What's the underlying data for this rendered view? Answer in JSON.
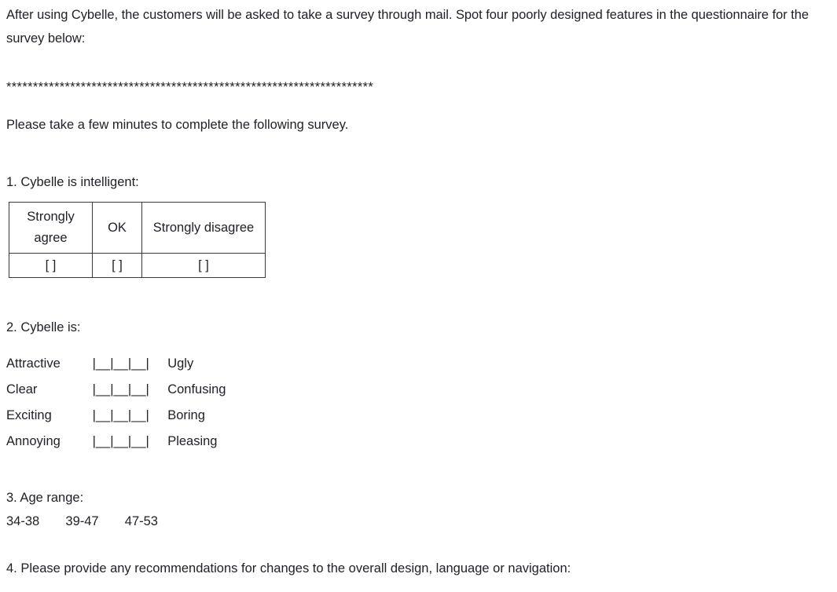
{
  "document": {
    "intro": "After using Cybelle, the customers will be asked to take a survey through mail. Spot four poorly designed features in the questionnaire for the survey below:",
    "separator": "*********************************************************************",
    "instruction": "Please take a few minutes to complete the following survey.",
    "text_color": "#21212a",
    "background_color": "#ffffff",
    "border_color": "#3a3a3a"
  },
  "questions": [
    {
      "id": "q1",
      "label": "1. Cybelle is intelligent:",
      "type": "table",
      "table": {
        "headers": [
          "Strongly agree",
          "OK",
          "Strongly disagree"
        ],
        "cells": [
          "[ ]",
          "[ ]",
          "[ ]"
        ]
      }
    },
    {
      "id": "q2",
      "label": "2. Cybelle is:",
      "type": "semantic-differential",
      "scale_marker": "|__|__|__|",
      "rows": [
        {
          "left": "Attractive",
          "scale": "|__|__|__|",
          "right": "Ugly"
        },
        {
          "left": "Clear",
          "scale": "|__|__|__|",
          "right": "Confusing"
        },
        {
          "left": "Exciting",
          "scale": "|__|__|__|",
          "right": "Boring"
        },
        {
          "left": "Annoying",
          "scale": "|__|__|__|",
          "right": "Pleasing"
        }
      ]
    },
    {
      "id": "q3",
      "label": "3. Age range:",
      "type": "options",
      "options": [
        "34-38",
        "39-47",
        "47-53"
      ]
    },
    {
      "id": "q4",
      "label": "4. Please provide any recommendations for changes to the overall design, language or navigation:",
      "type": "open-ended"
    }
  ]
}
